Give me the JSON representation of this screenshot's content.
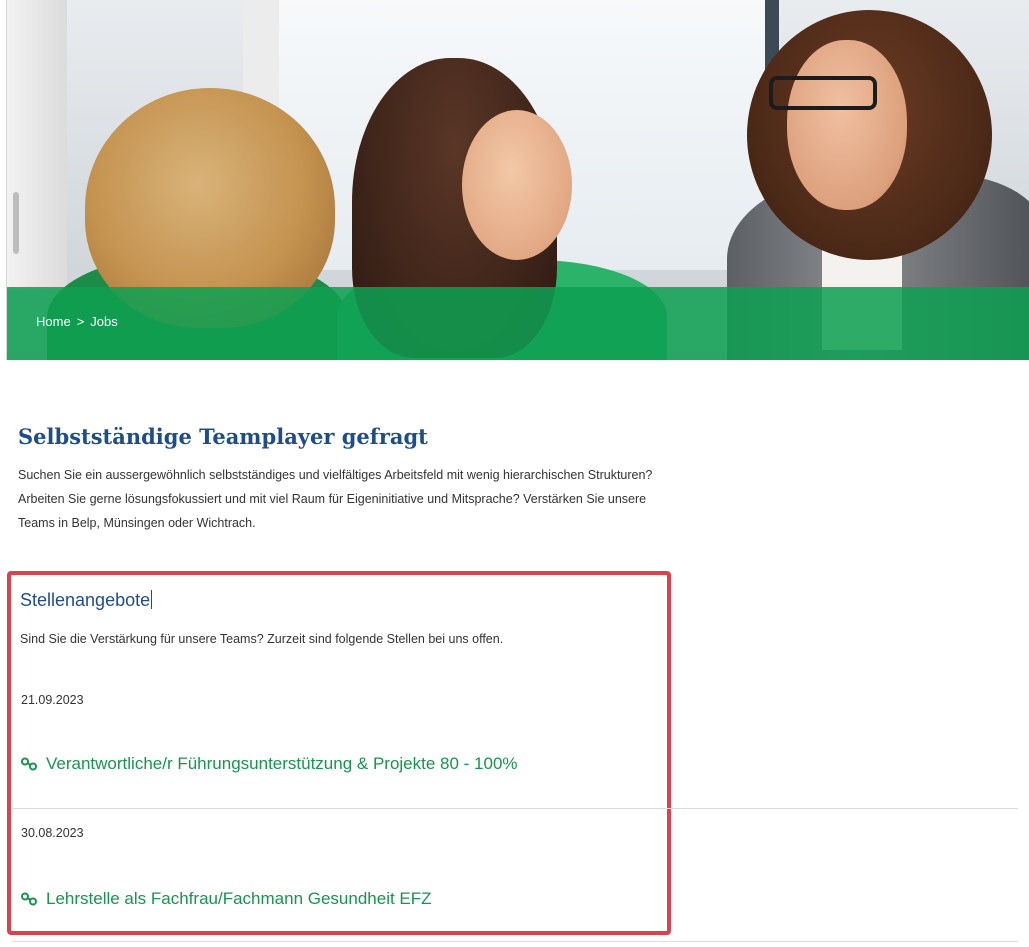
{
  "breadcrumb": {
    "home": "Home",
    "separator": ">",
    "current": "Jobs"
  },
  "page": {
    "title": "Selbstständige Teamplayer gefragt",
    "intro_lines": [
      "Suchen Sie ein aussergewöhnlich selbstständiges und vielfältiges Arbeitsfeld mit wenig hierarchischen Strukturen?",
      "Arbeiten Sie gerne lösungsfokussiert und mit viel Raum für Eigeninitiative und Mitsprache? Verstärken Sie unsere",
      "Teams in Belp, Münsingen oder Wichtrach."
    ]
  },
  "jobs_section": {
    "title": "Stellenangebote",
    "description": "Sind Sie die Verstärkung für unsere Teams? Zurzeit sind folgende Stellen bei uns offen.",
    "items": [
      {
        "date": "21.09.2023",
        "title": "Verantwortliche/r Führungsunterstützung & Projekte 80 - 100%"
      },
      {
        "date": "30.08.2023",
        "title": "Lehrstelle als Fachfrau/Fachmann Gesundheit EFZ"
      }
    ]
  },
  "colors": {
    "brand_green": "#0ea052",
    "link_green": "#1a9350",
    "heading_blue": "#1f4d88",
    "highlight_red": "#d9434f"
  },
  "icons": {
    "job_link": "link-icon"
  }
}
